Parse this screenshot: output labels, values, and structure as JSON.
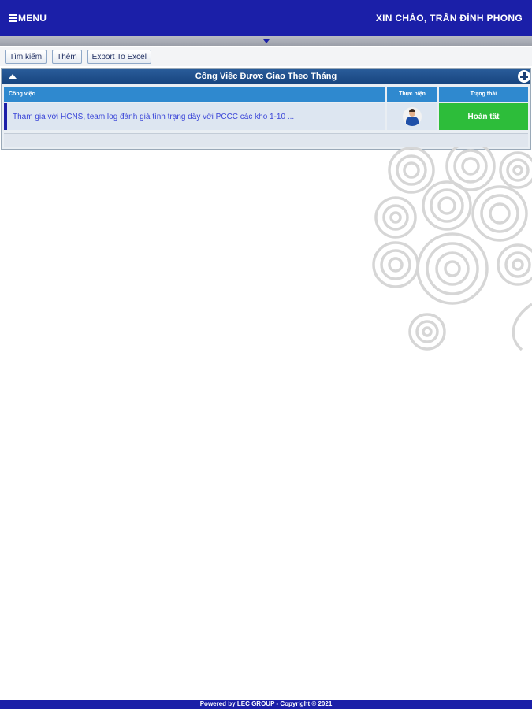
{
  "header": {
    "menu_label": "MENU",
    "greeting": "XIN CHÀO, TRẦN ĐÌNH PHONG"
  },
  "toolbar": {
    "search_label": "Tìm kiếm",
    "add_label": "Thêm",
    "export_label": "Export To Excel"
  },
  "panel": {
    "title": "Công Việc Được Giao Theo Tháng",
    "columns": {
      "work": "Công việc",
      "assignee": "Thực hiện",
      "status": "Trạng thái"
    },
    "rows": [
      {
        "work": "Tham gia với HCNS, team log đánh giá tình trạng dây với PCCC các kho 1-10 ...",
        "status": "Hoàn tất"
      }
    ]
  },
  "footer": {
    "text": "Powered by LEC GROUP - Copyright © 2021"
  },
  "colors": {
    "brand": "#1b1fa8",
    "header_blue": "#2f89cf",
    "status_done": "#2dbd3a"
  }
}
